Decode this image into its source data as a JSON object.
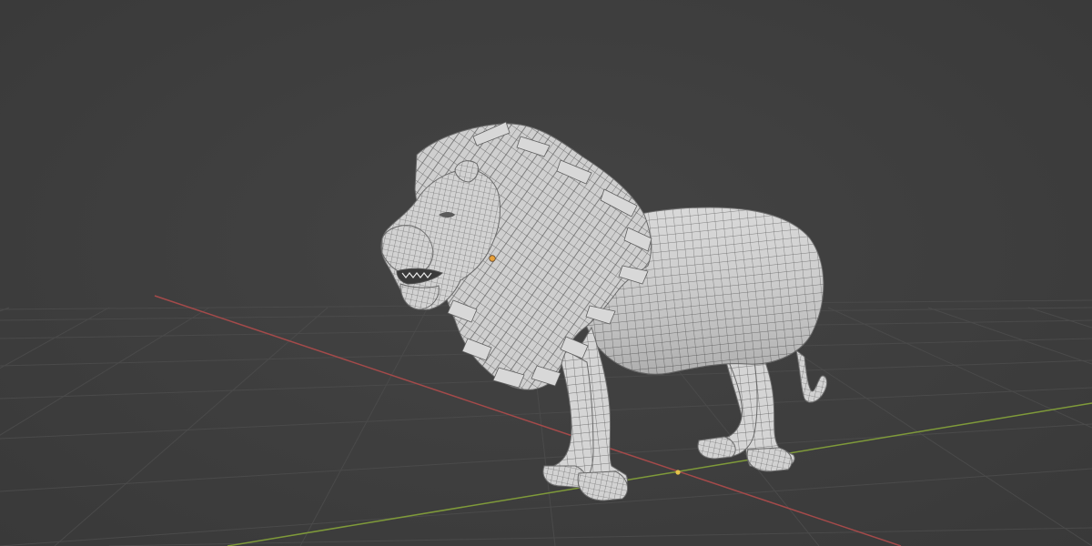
{
  "viewport": {
    "view": "3d-viewport",
    "object": "lion-mesh",
    "display_mode": "wireframe-overlay",
    "colors": {
      "background": "#3d3d3d",
      "grid_line": "#4a4a4a",
      "x_axis": "#b34a4a",
      "y_axis": "#86a33a",
      "mesh_fill": "#d6d6d6",
      "mesh_edge": "#555555",
      "origin_dot": "#e8a13a",
      "world_origin": "#e6c24a"
    }
  }
}
